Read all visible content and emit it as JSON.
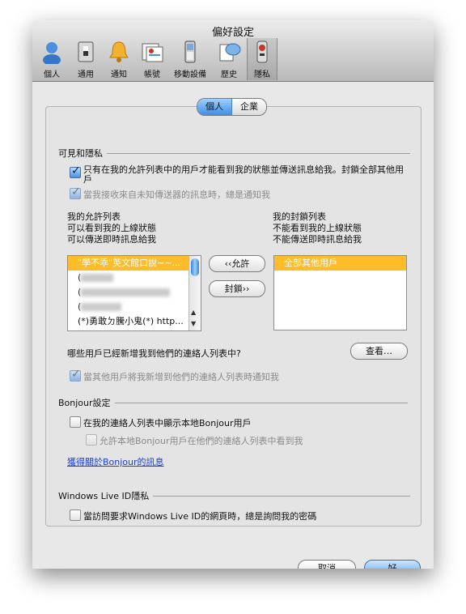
{
  "window": {
    "title": "偏好設定"
  },
  "toolbar": {
    "items": [
      {
        "label": "個人",
        "icon": "person-icon"
      },
      {
        "label": "通用",
        "icon": "switch-icon"
      },
      {
        "label": "通知",
        "icon": "bell-icon"
      },
      {
        "label": "帳號",
        "icon": "accounts-icon"
      },
      {
        "label": "移動設備",
        "icon": "mobile-phone-icon"
      },
      {
        "label": "歷史",
        "icon": "history-icon"
      },
      {
        "label": "隱私",
        "icon": "privacy-icon"
      }
    ],
    "selected": "隱私"
  },
  "segment": {
    "personal": "個人",
    "business": "企業",
    "selected": "個人"
  },
  "visibility": {
    "heading": "可見和隱私",
    "allow_only_label": "只有在我的允許列表中的用戶才能看到我的狀態並傳送訊息給我。封鎖全部其他用戶",
    "allow_only_line1": "只有在我的允許列表中的用戶才能看到我的狀態並傳送訊息給我。封鎖全部其他用",
    "allow_only_line2": "戶",
    "notify_unknown_label": "當我接收來自未知傳送器的訊息時，總是通知我",
    "allow_list_title": "我的允許列表",
    "allow_list_desc1": "可以看到我的上線狀態",
    "allow_list_desc2": "可以傳送即時訊息給我",
    "block_list_title": "我的封鎖列表",
    "block_list_desc1": "不能看到我的上線狀態",
    "block_list_desc2": "不能傳送即時訊息給我",
    "allow_list_items": [
      "\"學不乖\"英文館口說~~...",
      "(",
      "(",
      "(",
      "(*)勇敢ㄉ騰小鬼(*) http..."
    ],
    "block_list_items": [
      "全部其他用戶"
    ],
    "allow_button": "‹‹允許",
    "block_button": "封鎖››",
    "who_added_question": "哪些用戶已經新增我到他們的連絡人列表中?",
    "view_button": "查看…",
    "notify_added_label": "當其他用戶將我新增到他們的連絡人列表時通知我"
  },
  "bonjour": {
    "heading": "Bonjour設定",
    "show_local_label": "在我的連絡人列表中顯示本地Bonjour用戶",
    "allow_see_label": "允許本地Bonjour用戶在他們的連絡人列表中看到我",
    "info_link": "獲得關於Bonjour的訊息"
  },
  "windows_live": {
    "heading": "Windows Live ID隱私",
    "ask_password_label": "當訪問要求Windows Live ID的網頁時，總是詢問我的密碼"
  },
  "footer": {
    "cancel": "取消",
    "ok": "好"
  }
}
